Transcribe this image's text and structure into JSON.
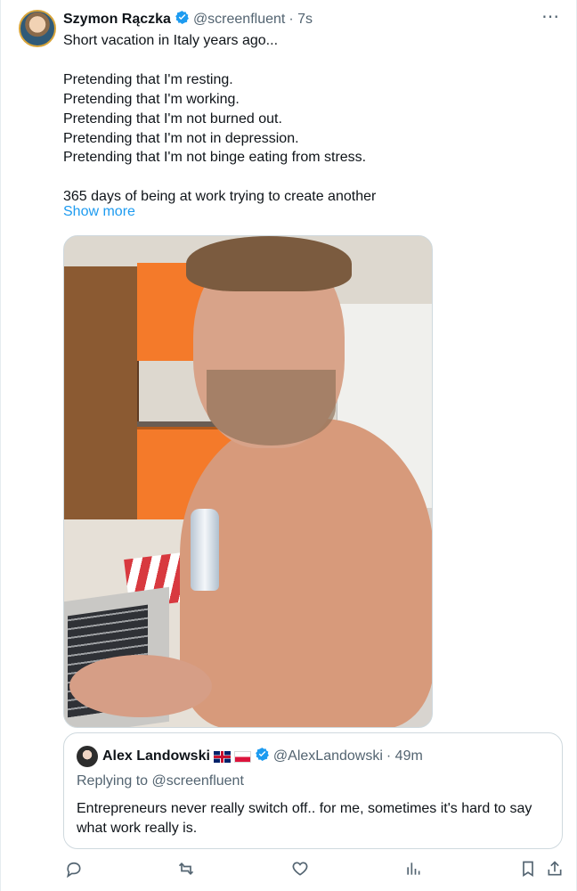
{
  "tweet": {
    "author_name": "Szymon Rączka",
    "author_handle": "@screenfluent",
    "time": "· 7s",
    "text": "Short vacation in Italy years ago...\n\nPretending that I'm resting.\nPretending that I'm working.\nPretending that I'm not burned out.\nPretending that I'm not in depression.\nPretending that I'm not binge eating from stress.\n\n365 days of being at work trying to create another",
    "show_more": "Show more",
    "more_icon": "more-horizontal-icon"
  },
  "quote": {
    "author_name": "Alex Landowski",
    "flags": [
      "uk-flag-icon",
      "poland-flag-icon"
    ],
    "author_handle": "@AlexLandowski",
    "time": "· 49m",
    "replying_to": "Replying to @screenfluent",
    "text": "Entrepreneurs never really switch off.. for me, sometimes it's hard to say what work really is."
  },
  "actions": [
    {
      "name": "reply",
      "icon": "reply-icon"
    },
    {
      "name": "repost",
      "icon": "repost-icon"
    },
    {
      "name": "like",
      "icon": "like-icon"
    },
    {
      "name": "views",
      "icon": "views-icon"
    },
    {
      "name": "bookmark",
      "icon": "bookmark-icon"
    },
    {
      "name": "share",
      "icon": "share-icon"
    }
  ],
  "colors": {
    "text": "#0f1419",
    "muted": "#536471",
    "link": "#1d9bf0",
    "border": "#cfd9de",
    "verified": "#1d9bf0"
  }
}
